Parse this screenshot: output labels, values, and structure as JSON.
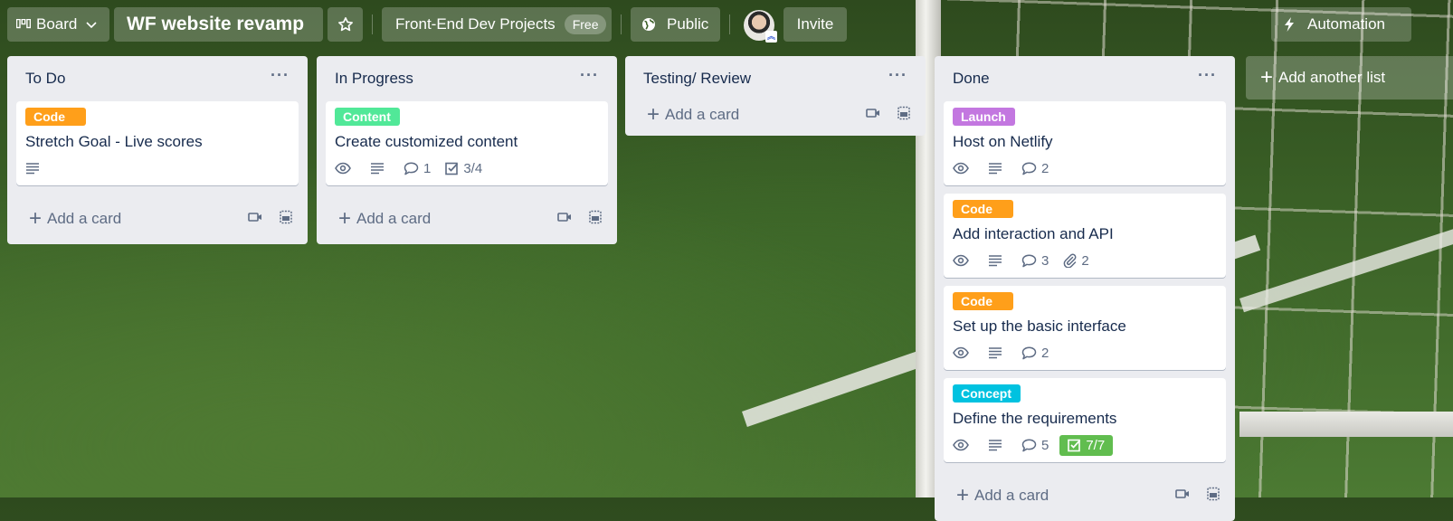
{
  "header": {
    "view_switcher": {
      "label": "Board",
      "icon": "board-icon"
    },
    "board_title": "WF website revamp",
    "star_icon": "star-icon",
    "workspace": {
      "name": "Front-End Dev Projects",
      "plan_badge": "Free"
    },
    "visibility": {
      "label": "Public",
      "icon": "globe-icon"
    },
    "member_avatar": "avatar",
    "invite_label": "Invite",
    "automation": {
      "label": "Automation",
      "icon": "lightning-icon"
    }
  },
  "colors": {
    "label_code": "#ff9f1a",
    "label_content": "#51e898",
    "label_launch": "#c377e0",
    "label_concept": "#00c2e0",
    "checklist_complete": "#61bd4f",
    "list_bg": "#ebecf0",
    "text_primary": "#172b4d",
    "text_muted": "#5e6c84"
  },
  "add_card_label": "Add a card",
  "add_list_label": "Add another list",
  "lists": [
    {
      "title": "To Do",
      "cards": [
        {
          "label": "Code",
          "label_color": "#ff9f1a",
          "title": "Stretch Goal - Live scores",
          "badges": {
            "watch": false,
            "description": true
          }
        }
      ]
    },
    {
      "title": "In Progress",
      "cards": [
        {
          "label": "Content",
          "label_color": "#51e898",
          "title": "Create customized content",
          "badges": {
            "watch": true,
            "description": true,
            "comments": "1",
            "checklist": "3/4"
          }
        }
      ]
    },
    {
      "title": "Testing/ Review",
      "cards": []
    },
    {
      "title": "Done",
      "cards": [
        {
          "label": "Launch",
          "label_color": "#c377e0",
          "title": "Host on Netlify",
          "badges": {
            "watch": true,
            "description": true,
            "comments": "2"
          }
        },
        {
          "label": "Code",
          "label_color": "#ff9f1a",
          "title": "Add interaction and API",
          "badges": {
            "watch": true,
            "description": true,
            "comments": "3",
            "attachments": "2"
          }
        },
        {
          "label": "Code",
          "label_color": "#ff9f1a",
          "title": "Set up the basic interface",
          "badges": {
            "watch": true,
            "description": true,
            "comments": "2"
          }
        },
        {
          "label": "Concept",
          "label_color": "#00c2e0",
          "title": "Define the requirements",
          "badges": {
            "watch": true,
            "description": true,
            "comments": "5",
            "checklist": "7/7",
            "checklist_complete": true
          }
        }
      ]
    }
  ]
}
